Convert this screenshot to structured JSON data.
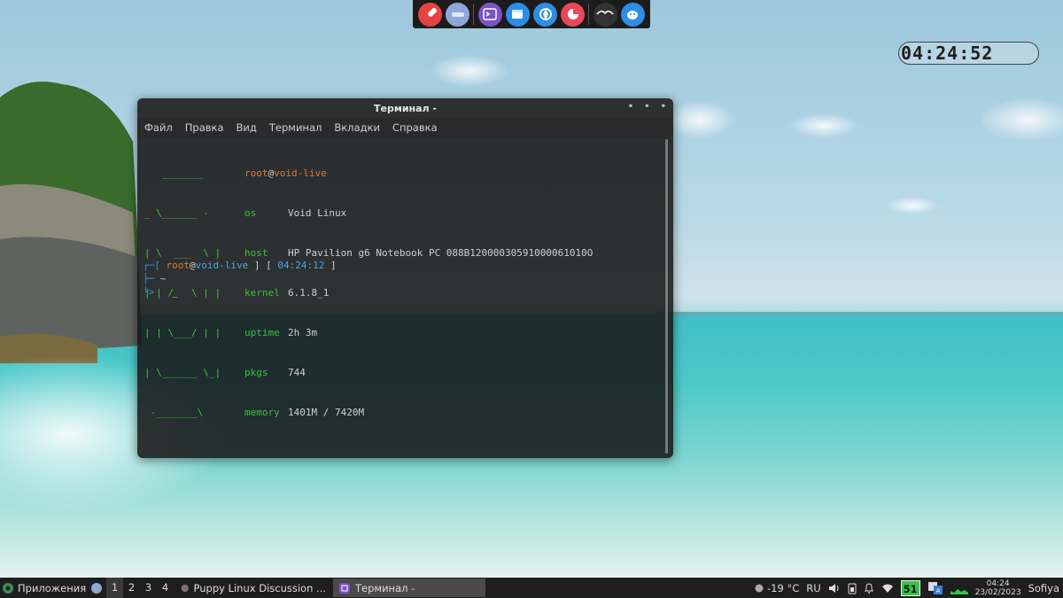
{
  "dock": {
    "items": [
      {
        "name": "rocket-launcher-icon",
        "color": "#e84343"
      },
      {
        "name": "drive-icon",
        "color": "#8fa6d8"
      },
      {
        "name": "terminal-app-icon",
        "color": "#7d52c6"
      },
      {
        "name": "file-manager-icon",
        "color": "#2c8ee6"
      },
      {
        "name": "web-browser-icon",
        "color": "#2c8ee6"
      },
      {
        "name": "pie-chart-app-icon",
        "color": "#e8485a"
      },
      {
        "name": "media-player-icon",
        "color": "#333333"
      },
      {
        "name": "puppy-icon",
        "color": "#2c8ee6"
      }
    ]
  },
  "clock": {
    "time": "04:24:52"
  },
  "terminal": {
    "title": "Терминал -",
    "menu": [
      "Файл",
      "Правка",
      "Вид",
      "Терминал",
      "Вкладки",
      "Справка"
    ],
    "logo_lines": [
      "   _______",
      "_ \\______ -",
      "| \\  ___  \\ |",
      "| | /   \\ | |",
      "| | \\___/ | |",
      "| \\______ \\_|",
      " -_______\\"
    ],
    "user": "root",
    "host": "void-live",
    "info": [
      {
        "key": "os",
        "value": "Void Linux"
      },
      {
        "key": "host",
        "value": "HP Pavilion g6 Notebook PC 088B12000030591000061010O"
      },
      {
        "key": "kernel",
        "value": "6.1.8_1"
      },
      {
        "key": "uptime",
        "value": "2h 3m"
      },
      {
        "key": "pkgs",
        "value": "744"
      },
      {
        "key": "memory",
        "value": "1401M / 7420M"
      }
    ],
    "prompt_time": "04:24:12",
    "cwd": "~",
    "cursor": "_"
  },
  "taskbar": {
    "apps_label": "Приложения",
    "workspaces": [
      "1",
      "2",
      "3",
      "4"
    ],
    "active_workspace": 0,
    "tasks": [
      {
        "label": "Puppy Linux Discussion ...",
        "active": false
      },
      {
        "label": "Терминал -",
        "active": true
      }
    ],
    "weather": "-19 °C",
    "keyboard_layout": "RU",
    "battery": "51",
    "time": "04:24",
    "date": "23/02/2023",
    "user": "Sofiya"
  }
}
